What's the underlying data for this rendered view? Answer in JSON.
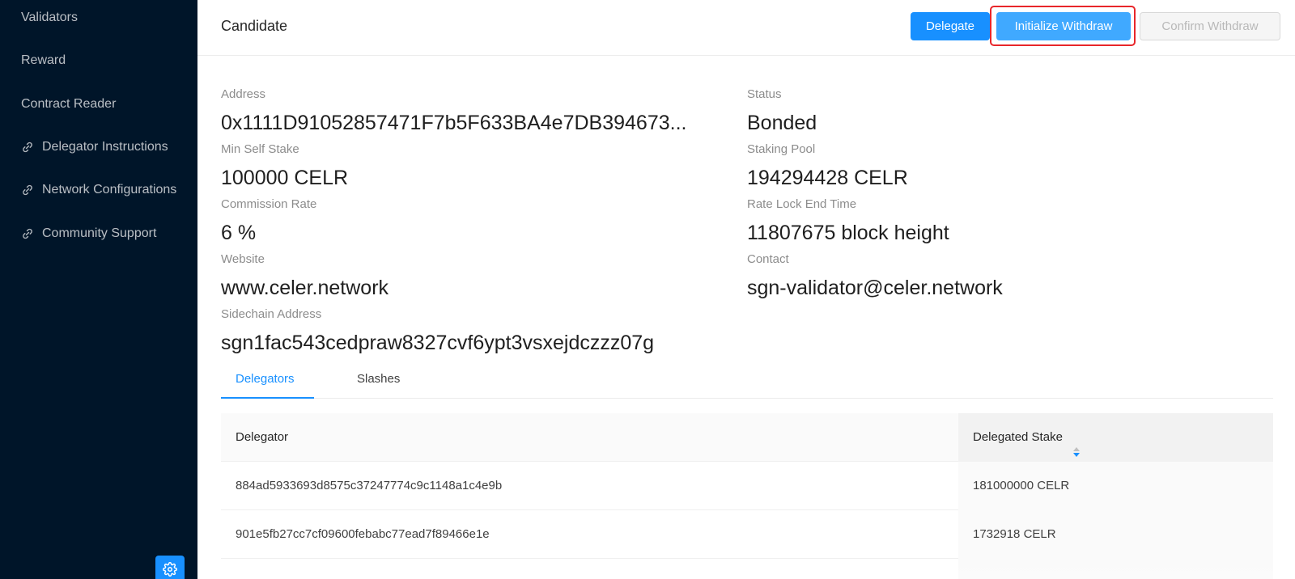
{
  "sidebar": {
    "items": [
      {
        "label": "Validators"
      },
      {
        "label": "Reward"
      },
      {
        "label": "Contract Reader"
      },
      {
        "label": "Delegator Instructions",
        "icon": "link-icon"
      },
      {
        "label": "Network Configurations",
        "icon": "link-icon"
      },
      {
        "label": "Community Support",
        "icon": "link-icon"
      }
    ],
    "settings_icon": "gear-icon"
  },
  "header": {
    "title": "Candidate",
    "buttons": {
      "delegate": "Delegate",
      "initialize_withdraw": "Initialize Withdraw",
      "confirm_withdraw": "Confirm Withdraw"
    }
  },
  "info": {
    "address": {
      "label": "Address",
      "value": "0x1111D91052857471F7b5F633BA4e7DB394673..."
    },
    "status": {
      "label": "Status",
      "value": "Bonded"
    },
    "min_self_stake": {
      "label": "Min Self Stake",
      "value": "100000 CELR"
    },
    "staking_pool": {
      "label": "Staking Pool",
      "value": "194294428 CELR"
    },
    "commission_rate": {
      "label": "Commission Rate",
      "value": "6 %"
    },
    "rate_lock_end_time": {
      "label": "Rate Lock End Time",
      "value": "11807675 block height"
    },
    "website": {
      "label": "Website",
      "value": "www.celer.network"
    },
    "contact": {
      "label": "Contact",
      "value": "sgn-validator@celer.network"
    },
    "sidechain_address": {
      "label": "Sidechain Address",
      "value": "sgn1fac543cedpraw8327cvf6ypt3vsxejdczzz07g"
    }
  },
  "tabs": [
    {
      "label": "Delegators",
      "active": true
    },
    {
      "label": "Slashes",
      "active": false
    }
  ],
  "table": {
    "columns": [
      "Delegator",
      "Delegated Stake"
    ],
    "rows": [
      {
        "delegator": "884ad5933693d8575c37247774c9c1148a1c4e9b",
        "stake": "181000000 CELR"
      },
      {
        "delegator": "901e5fb27cc7cf09600febabc77ead7f89466e1e",
        "stake": "1732918 CELR"
      },
      {
        "delegator": "",
        "stake": ""
      }
    ]
  },
  "colors": {
    "sidebar_bg": "#001529",
    "primary": "#1890ff",
    "highlight_border": "#e8262a"
  }
}
